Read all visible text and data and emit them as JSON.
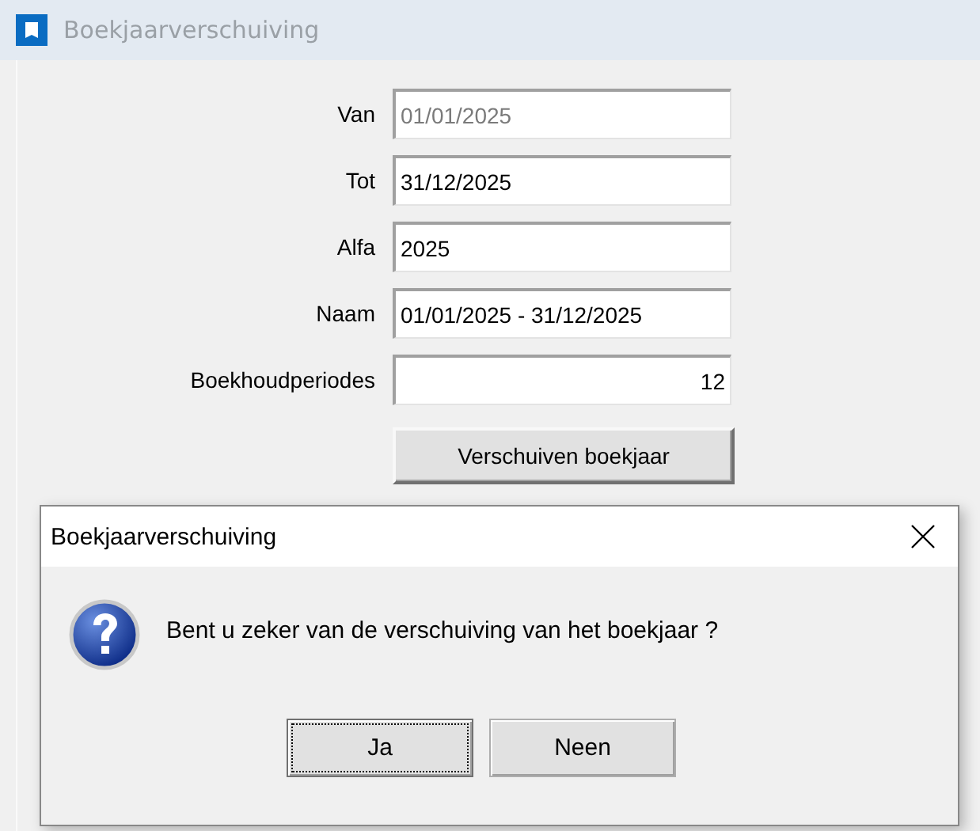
{
  "window": {
    "title": "Boekjaarverschuiving"
  },
  "fields": [
    {
      "label": "Van",
      "value": "01/01/2025",
      "kind": "text",
      "disabled": true
    },
    {
      "label": "Tot",
      "value": "31/12/2025",
      "kind": "text",
      "disabled": false
    },
    {
      "label": "Alfa",
      "value": "2025",
      "kind": "text",
      "disabled": false
    },
    {
      "label": "Naam",
      "value": "01/01/2025 - 31/12/2025",
      "kind": "text",
      "disabled": false
    },
    {
      "label": "Boekhoudperiodes",
      "value": "12",
      "kind": "number",
      "disabled": false
    }
  ],
  "action_button": "Verschuiven boekjaar",
  "dialog": {
    "title": "Boekjaarverschuiving",
    "message": "Bent u zeker van de verschuiving van het boekjaar ?",
    "buttons": [
      {
        "label": "Ja",
        "focused": true
      },
      {
        "label": "Neen",
        "focused": false
      }
    ]
  }
}
